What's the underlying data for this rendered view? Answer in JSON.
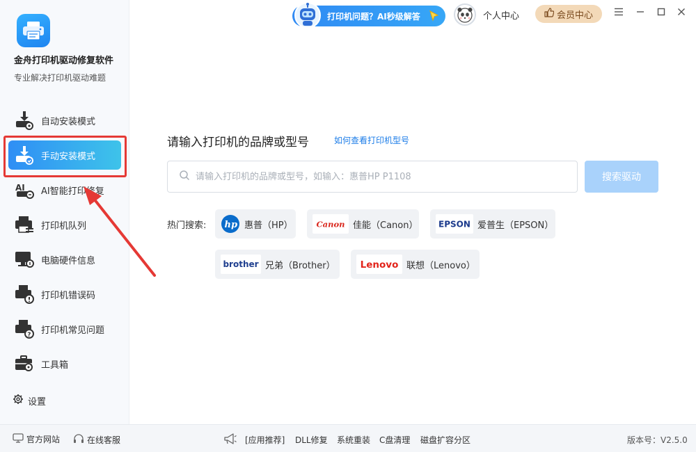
{
  "app": {
    "title": "金舟打印机驱动修复软件",
    "subtitle": "专业解决打印机驱动难题"
  },
  "sidebar": {
    "items": [
      {
        "label": "自动安装模式",
        "icon": "auto-install-icon"
      },
      {
        "label": "手动安装模式",
        "icon": "manual-install-icon",
        "active": true
      },
      {
        "label": "AI智能打印修复",
        "icon": "ai-repair-icon"
      },
      {
        "label": "打印机队列",
        "icon": "printer-queue-icon"
      },
      {
        "label": "电脑硬件信息",
        "icon": "monitor-icon"
      },
      {
        "label": "打印机错误码",
        "icon": "printer-error-icon"
      },
      {
        "label": "打印机常见问题",
        "icon": "printer-faq-icon"
      },
      {
        "label": "工具箱",
        "icon": "toolbox-icon"
      }
    ],
    "settings_label": "设置"
  },
  "topbar": {
    "ai_button": "打印机问题？AI秒级解答",
    "personal_center": "个人中心",
    "vip_center": "会员中心"
  },
  "main": {
    "prompt_title": "请输入打印机的品牌或型号",
    "help_link": "如何查看打印机型号",
    "search_placeholder": "请输入打印机的品牌或型号，如输入：惠普HP P1108",
    "search_button": "搜索驱动",
    "hot_label": "热门搜索:",
    "brands": [
      {
        "logo": "hp",
        "name": "惠普（HP）"
      },
      {
        "logo": "Canon",
        "name": "佳能（Canon）"
      },
      {
        "logo": "EPSON",
        "name": "爱普生（EPSON）"
      },
      {
        "logo": "brother",
        "name": "兄弟（Brother）"
      },
      {
        "logo": "Lenovo",
        "name": "联想（Lenovo）"
      }
    ]
  },
  "footer": {
    "official_site": "官方网站",
    "online_service": "在线客服",
    "links": [
      "[应用推荐]",
      "DLL修复",
      "系统重装",
      "C盘清理",
      "磁盘扩容分区"
    ],
    "version": "版本号：V2.5.0"
  },
  "colors": {
    "accent": "#2f8ef5",
    "active_gradient_end": "#3ec3ea",
    "search_button": "#a9d2fb",
    "vip_bg": "#f3d9b8",
    "annotation_red": "#e53935"
  }
}
